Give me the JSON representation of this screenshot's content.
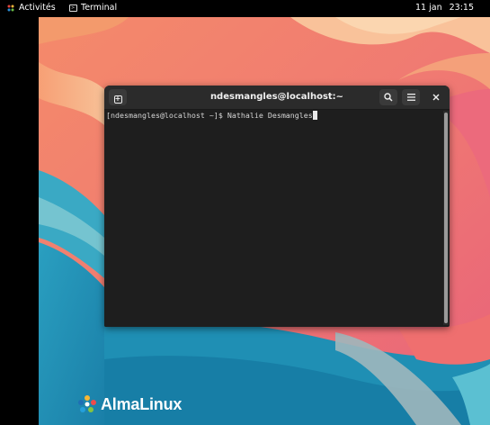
{
  "topbar": {
    "activities_label": "Activités",
    "app_name": "Terminal",
    "date": "11 jan",
    "time": "23:15"
  },
  "terminal": {
    "title": "ndesmangles@localhost:~",
    "prompt": "[ndesmangles@localhost ~]$ ",
    "command": "Nathalie Desmangles"
  },
  "brand": {
    "name": "AlmaLinux"
  },
  "icons": {
    "new_tab": "new-tab-icon",
    "search": "search-icon",
    "menu": "hamburger-menu-icon",
    "close": "close-icon"
  },
  "colors": {
    "terminal_bg": "#1e1e1e",
    "titlebar_bg": "#2b2b2b",
    "topbar_bg": "#000000"
  }
}
